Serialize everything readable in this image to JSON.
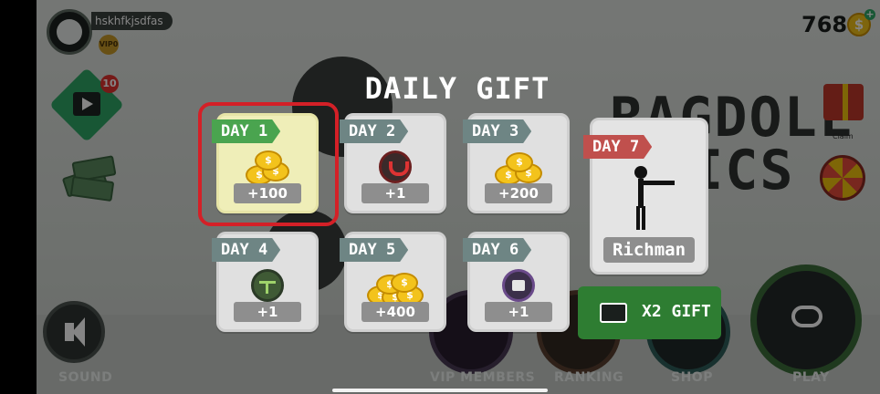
{
  "player": {
    "username": "hskhfkjsdfas",
    "vip_badge": "VIP0"
  },
  "hud": {
    "coins": "768",
    "coin_symbol": "$",
    "video_badge": "10",
    "claim_label": "Claim"
  },
  "background": {
    "game_title_line1": "RAGDOLL",
    "game_title_line2": "SICS"
  },
  "nav": {
    "sound": "SOUND",
    "vip": "VIP MEMBERS",
    "ranking": "RANKING",
    "shop": "SHOP",
    "play": "PLAY"
  },
  "dialog": {
    "title": "DAILY GIFT",
    "days": [
      {
        "label": "DAY 1",
        "amount": "+100",
        "icon": "coin-stack-icon"
      },
      {
        "label": "DAY 2",
        "amount": "+1",
        "icon": "magnet-item-icon"
      },
      {
        "label": "DAY 3",
        "amount": "+200",
        "icon": "coin-stack-icon"
      },
      {
        "label": "DAY 4",
        "amount": "+1",
        "icon": "glider-item-icon"
      },
      {
        "label": "DAY 5",
        "amount": "+400",
        "icon": "coin-pile-icon"
      },
      {
        "label": "DAY 6",
        "amount": "+1",
        "icon": "gift-item-icon"
      }
    ],
    "day7": {
      "label": "DAY 7",
      "reward": "Richman",
      "icon": "stickman-skin-icon"
    },
    "x2_button": "X2 GIFT"
  },
  "colors": {
    "today_tag": "#4aa44f",
    "day7_tag": "#c0504d",
    "highlight": "#d42027",
    "x2_button": "#2e7d32"
  }
}
